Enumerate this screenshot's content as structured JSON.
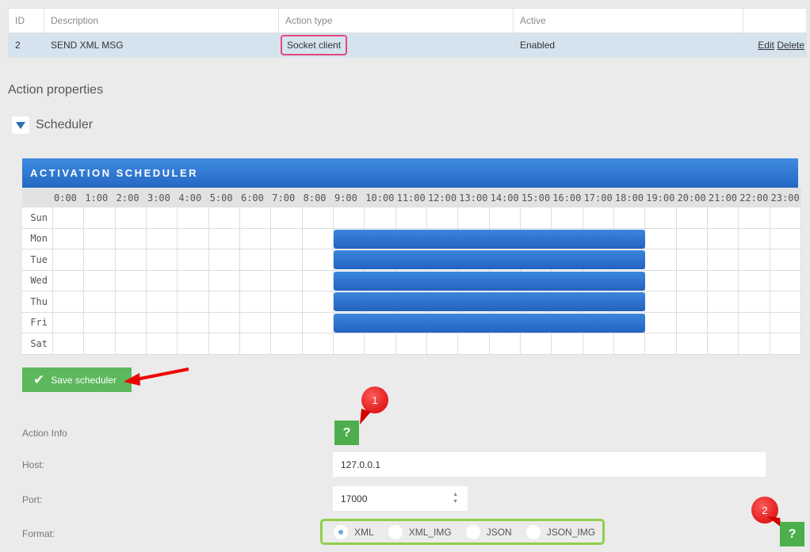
{
  "table": {
    "headers": [
      "ID",
      "Description",
      "Action type",
      "Active",
      ""
    ],
    "row": {
      "id": "2",
      "description": "SEND XML MSG",
      "action_type": "Socket client",
      "active": "Enabled",
      "edit": "Edit",
      "delete": "Delete"
    }
  },
  "section_title": "Action properties",
  "scheduler_toggle_label": "Scheduler",
  "scheduler": {
    "header": "ACTIVATION SCHEDULER",
    "hours": [
      "0:00",
      "1:00",
      "2:00",
      "3:00",
      "4:00",
      "5:00",
      "6:00",
      "7:00",
      "8:00",
      "9:00",
      "10:00",
      "11:00",
      "12:00",
      "13:00",
      "14:00",
      "15:00",
      "16:00",
      "17:00",
      "18:00",
      "19:00",
      "20:00",
      "21:00",
      "22:00",
      "23:00"
    ],
    "days": [
      "Sun",
      "Mon",
      "Tue",
      "Wed",
      "Thu",
      "Fri",
      "Sat"
    ],
    "active_days": [
      "Mon",
      "Tue",
      "Wed",
      "Thu",
      "Fri"
    ],
    "active_from_hour": 9,
    "active_to_hour": 19,
    "active_color": "#2a72cf"
  },
  "save_label": "Save scheduler",
  "form": {
    "action_info_label": "Action Info",
    "help_label": "?",
    "host_label": "Host:",
    "host_value": "127.0.0.1",
    "port_label": "Port:",
    "port_value": "17000",
    "format_label": "Format:",
    "format_options": [
      "XML",
      "XML_IMG",
      "JSON",
      "JSON_IMG"
    ],
    "format_selected": "XML"
  },
  "annotations": {
    "badge_1": "1",
    "badge_2": "2",
    "highlight_color": "#e4477a",
    "group_highlight_color": "#8fcf4a"
  }
}
